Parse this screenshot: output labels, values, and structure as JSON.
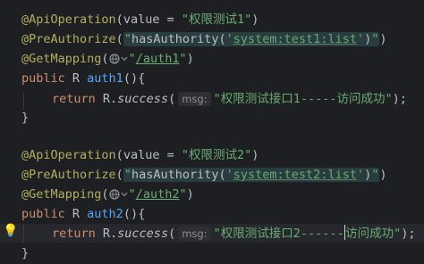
{
  "method1": {
    "op_annotation": "@ApiOperation",
    "op_param": "value = ",
    "op_value": "\"权限测试1\"",
    "pre_annotation": "@PreAuthorize",
    "pre_hasauth": "hasAuthority",
    "pre_value": "system:test1:list",
    "get_annotation": "@GetMapping",
    "get_value": "/auth1",
    "sig_public": "public",
    "sig_type": " R ",
    "sig_name": "auth1",
    "sig_rest": "(){",
    "ret_kw": "return",
    "ret_class": " R.",
    "ret_method": "success",
    "ret_hint": "msg:",
    "ret_value": "\"权限测试接口1-----访问成功\"",
    "ret_end": ");",
    "close": "}"
  },
  "method2": {
    "op_annotation": "@ApiOperation",
    "op_param": "value = ",
    "op_value": "\"权限测试2\"",
    "pre_annotation": "@PreAuthorize",
    "pre_hasauth": "hasAuthority",
    "pre_value": "system:test2:list",
    "get_annotation": "@GetMapping",
    "get_value": "/auth2",
    "sig_public": "public",
    "sig_type": " R ",
    "sig_name": "auth2",
    "sig_rest": "(){",
    "ret_kw": "return",
    "ret_class": " R.",
    "ret_method": "success",
    "ret_hint": "msg:",
    "ret_value_a": "\"权限测试接口2------",
    "ret_value_b": "访问成功\"",
    "ret_end": ");",
    "close": "}"
  },
  "icons": {
    "globe": "globe-icon",
    "chevron": "chevron-down-icon",
    "bulb": "lightbulb-icon"
  },
  "colors": {
    "background": "#1e1f22",
    "annotation": "#b3ae60",
    "keyword": "#cf8e6d",
    "method_name": "#56a8f5",
    "string": "#6aab73",
    "injection_bg": "#293c40"
  }
}
